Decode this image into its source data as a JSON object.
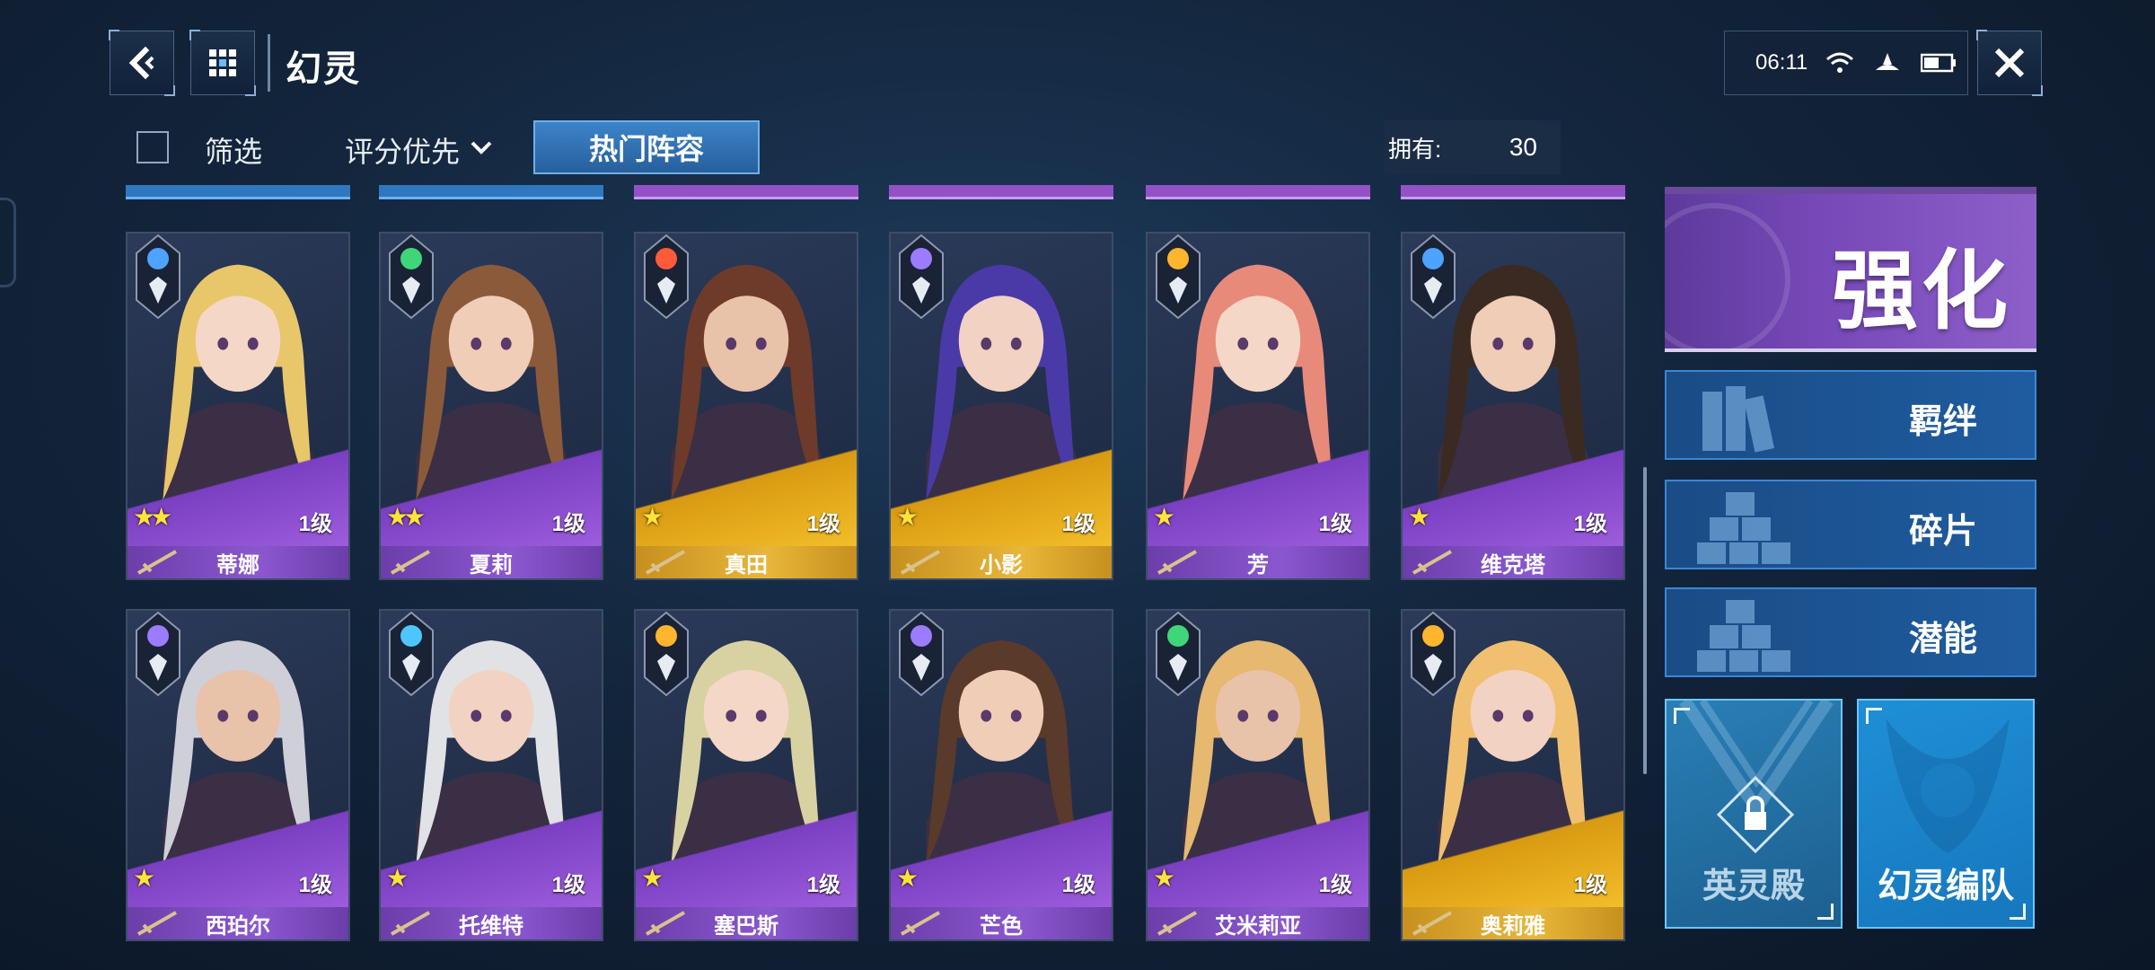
{
  "header": {
    "title": "幻灵",
    "back_icon": "back-arrow-icon",
    "menu_icon": "grid-menu-icon"
  },
  "status": {
    "time": "06:11"
  },
  "toolbar": {
    "filter_label": "筛选",
    "sort_label": "评分优先",
    "hot_lineup_label": "热门阵容",
    "owned_label": "拥有:",
    "owned_value": "30"
  },
  "characters": [
    {
      "name": "蒂娜",
      "level": "1级",
      "stars": "★★",
      "rarity": "purple",
      "element_color": "#4da3ff"
    },
    {
      "name": "夏莉",
      "level": "1级",
      "stars": "★★",
      "rarity": "purple",
      "element_color": "#3fd67a"
    },
    {
      "name": "真田",
      "level": "1级",
      "stars": "★",
      "rarity": "gold",
      "element_color": "#ff5a3a"
    },
    {
      "name": "小影",
      "level": "1级",
      "stars": "★",
      "rarity": "gold",
      "element_color": "#9b7cff"
    },
    {
      "name": "芳",
      "level": "1级",
      "stars": "★",
      "rarity": "purple",
      "element_color": "#ffb52e"
    },
    {
      "name": "维克塔",
      "level": "1级",
      "stars": "★",
      "rarity": "purple",
      "element_color": "#4da3ff"
    },
    {
      "name": "西珀尔",
      "level": "1级",
      "stars": "★",
      "rarity": "purple",
      "element_color": "#9b7cff"
    },
    {
      "name": "托维特",
      "level": "1级",
      "stars": "★",
      "rarity": "purple",
      "element_color": "#4dc6ff"
    },
    {
      "name": "塞巴斯",
      "level": "1级",
      "stars": "★",
      "rarity": "purple",
      "element_color": "#ffb52e"
    },
    {
      "name": "芒色",
      "level": "1级",
      "stars": "★",
      "rarity": "purple",
      "element_color": "#9b7cff"
    },
    {
      "name": "艾米莉亚",
      "level": "1级",
      "stars": "★",
      "rarity": "purple",
      "element_color": "#3fd67a"
    },
    {
      "name": "奥莉雅",
      "level": "1级",
      "stars": "",
      "rarity": "gold",
      "element_color": "#ffb52e"
    }
  ],
  "side_panel": {
    "enhance_label": "强化",
    "bond_label": "羁绊",
    "fragment_label": "碎片",
    "potential_label": "潜能",
    "hall_label": "英灵殿",
    "team_label": "幻灵编队"
  }
}
